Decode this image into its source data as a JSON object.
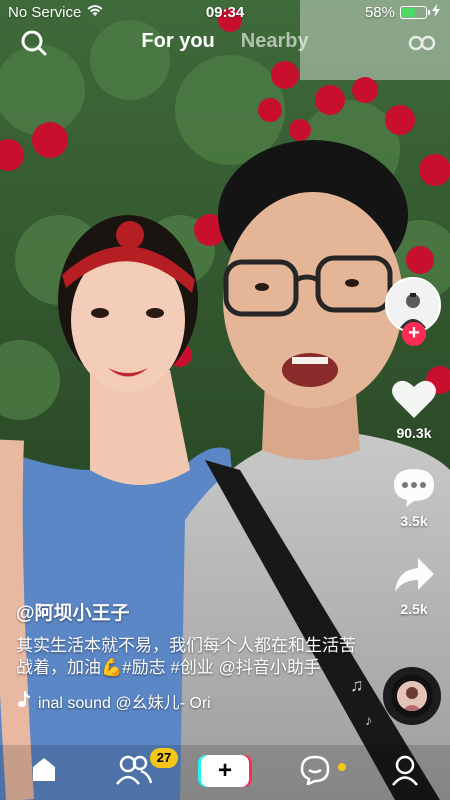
{
  "status_bar": {
    "carrier": "No Service",
    "time": "09:34",
    "battery": "58%",
    "battery_level": 0.58,
    "icons": [
      "wifi-icon",
      "battery-icon",
      "charging-icon"
    ]
  },
  "top_nav": {
    "tabs": [
      {
        "label": "For you",
        "active": true
      },
      {
        "label": "Nearby",
        "active": false
      }
    ],
    "icons": [
      "search-icon",
      "live-icon"
    ]
  },
  "actions": {
    "likes": "90.3k",
    "comments": "3.5k",
    "shares": "2.5k",
    "follow_symbol": "+",
    "icons": [
      "heart-icon",
      "comment-icon",
      "share-icon"
    ]
  },
  "caption": {
    "username": "@阿坝小王子",
    "description": "其实生活本就不易，我们每个人都在和生活苦战着，加油💪#励志 #创业 @抖音小助手",
    "music": "inal sound     @幺妹儿- Ori"
  },
  "bottom_bar": {
    "items": [
      "home-icon",
      "friends-icon",
      "create-button",
      "inbox-icon",
      "profile-icon"
    ],
    "friends_badge": "27",
    "create_symbol": "+"
  },
  "colors": {
    "accent_red": "#fe2c55",
    "accent_cyan": "#25f4ee",
    "badge_yellow": "#f5c518",
    "battery_green": "#4cd964"
  }
}
